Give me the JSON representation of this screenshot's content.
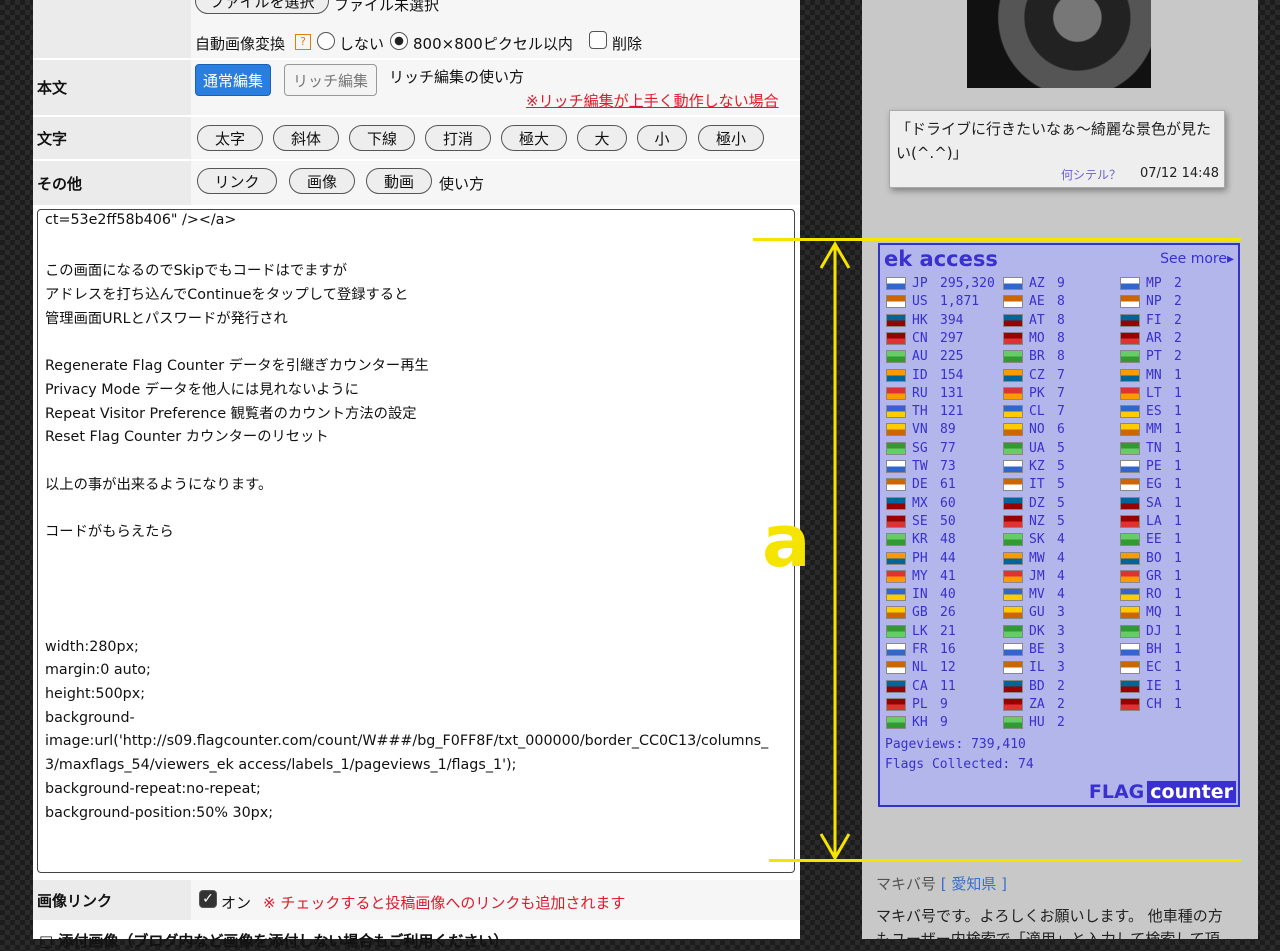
{
  "upload": {
    "button": "ファイルを選択",
    "status": "ファイル未選択"
  },
  "autoconv": {
    "label": "自動画像変換",
    "help": "?",
    "opt_none": "しない",
    "opt_size": "800×800ピクセル以内",
    "opt_delete": "削除"
  },
  "body_row": {
    "label": "本文",
    "normal": "通常編集",
    "rich": "リッチ編集",
    "howto": "リッチ編集の使い方",
    "warn": "※リッチ編集が上手く動作しない場合"
  },
  "moji_row": {
    "label": "文字",
    "buttons": [
      "太字",
      "斜体",
      "下線",
      "打消",
      "極大",
      "大",
      "小",
      "極小"
    ]
  },
  "other_row": {
    "label": "その他",
    "buttons": [
      "リンク",
      "画像",
      "動画"
    ],
    "howto": "使い方"
  },
  "editor_lines": [
    "ct=53e2ff58b406\" /></a>",
    "",
    "この画面になるのでSkipでもコードはでますが",
    "アドレスを打ち込んでContinueをタップして登録すると",
    "管理画面URLとパスワードが発行され",
    "",
    "Regenerate Flag Counter データを引継ぎカウンター再生",
    "Privacy Mode データを他人には見れないように",
    "Repeat Visitor Preference 観覧者のカウント方法の設定",
    "Reset Flag Counter カウンターのリセット",
    "",
    "以上の事が出来るようになります。",
    "",
    "コードがもらえたら",
    "",
    "",
    "",
    "",
    "width:280px;",
    "margin:0 auto;",
    "height:500px;",
    "background-",
    "image:url('http://s09.flagcounter.com/count/W###/bg_F0FF8F/txt_000000/border_CC0C13/columns_",
    "3/maxflags_54/viewers_ek access/labels_1/pageviews_1/flags_1');",
    "background-repeat:no-repeat;",
    "background-position:50% 30px;"
  ],
  "image_link": {
    "label": "画像リンク",
    "on": "オン",
    "note": "※ チェックすると投稿画像へのリンクも追加されます"
  },
  "bottom_text": "□ 添付画像（ブログ内など画像を添付しない場合もご利用ください）",
  "side": {
    "comment_text": "「ドライブに行きたいなぁ〜綺麗な景色が見たい(^.^)」",
    "comment_link": "何シテル？",
    "comment_time": "07/12 14:48",
    "profile_name": "マキバ号",
    "profile_pref": "[ 愛知県 ]",
    "profile_text1": "マキバ号です。よろしくお願いします。 他車種の方",
    "profile_text2": "もユーザー内検索で「適用」と入力して検索して頂"
  },
  "flag_counter": {
    "title": "ek access",
    "see_more": "See more▸",
    "col1": [
      [
        "JP",
        "295,320"
      ],
      [
        "US",
        "1,871"
      ],
      [
        "HK",
        "394"
      ],
      [
        "CN",
        "297"
      ],
      [
        "AU",
        "225"
      ],
      [
        "ID",
        "154"
      ],
      [
        "RU",
        "131"
      ],
      [
        "TH",
        "121"
      ],
      [
        "VN",
        "89"
      ],
      [
        "SG",
        "77"
      ],
      [
        "TW",
        "73"
      ],
      [
        "DE",
        "61"
      ],
      [
        "MX",
        "60"
      ],
      [
        "SE",
        "50"
      ],
      [
        "KR",
        "48"
      ],
      [
        "PH",
        "44"
      ],
      [
        "MY",
        "41"
      ],
      [
        "IN",
        "40"
      ],
      [
        "GB",
        "26"
      ],
      [
        "LK",
        "21"
      ],
      [
        "FR",
        "16"
      ],
      [
        "NL",
        "12"
      ],
      [
        "CA",
        "11"
      ],
      [
        "PL",
        "9"
      ],
      [
        "KH",
        "9"
      ]
    ],
    "col2": [
      [
        "AZ",
        "9"
      ],
      [
        "AE",
        "8"
      ],
      [
        "AT",
        "8"
      ],
      [
        "MO",
        "8"
      ],
      [
        "BR",
        "8"
      ],
      [
        "CZ",
        "7"
      ],
      [
        "PK",
        "7"
      ],
      [
        "CL",
        "7"
      ],
      [
        "NO",
        "6"
      ],
      [
        "UA",
        "5"
      ],
      [
        "KZ",
        "5"
      ],
      [
        "IT",
        "5"
      ],
      [
        "DZ",
        "5"
      ],
      [
        "NZ",
        "5"
      ],
      [
        "SK",
        "4"
      ],
      [
        "MW",
        "4"
      ],
      [
        "JM",
        "4"
      ],
      [
        "MV",
        "4"
      ],
      [
        "GU",
        "3"
      ],
      [
        "DK",
        "3"
      ],
      [
        "BE",
        "3"
      ],
      [
        "IL",
        "3"
      ],
      [
        "BD",
        "2"
      ],
      [
        "ZA",
        "2"
      ],
      [
        "HU",
        "2"
      ]
    ],
    "col3": [
      [
        "MP",
        "2"
      ],
      [
        "NP",
        "2"
      ],
      [
        "FI",
        "2"
      ],
      [
        "AR",
        "2"
      ],
      [
        "PT",
        "2"
      ],
      [
        "MN",
        "1"
      ],
      [
        "LT",
        "1"
      ],
      [
        "ES",
        "1"
      ],
      [
        "MM",
        "1"
      ],
      [
        "TN",
        "1"
      ],
      [
        "PE",
        "1"
      ],
      [
        "EG",
        "1"
      ],
      [
        "SA",
        "1"
      ],
      [
        "LA",
        "1"
      ],
      [
        "EE",
        "1"
      ],
      [
        "BO",
        "1"
      ],
      [
        "GR",
        "1"
      ],
      [
        "RO",
        "1"
      ],
      [
        "MQ",
        "1"
      ],
      [
        "DJ",
        "1"
      ],
      [
        "BH",
        "1"
      ],
      [
        "EC",
        "1"
      ],
      [
        "IE",
        "1"
      ],
      [
        "CH",
        "1"
      ]
    ],
    "pageviews": "Pageviews: 739,410",
    "flags_collected": "Flags Collected: 74",
    "brand_flag": "FLAG",
    "brand_counter": "counter"
  },
  "annotation_label": "a",
  "colors": {
    "accent_blue": "#2a7ee0",
    "warn_red": "#e0192b",
    "counter_text": "#3a2fd0",
    "annotation_yellow": "#f5e400"
  }
}
